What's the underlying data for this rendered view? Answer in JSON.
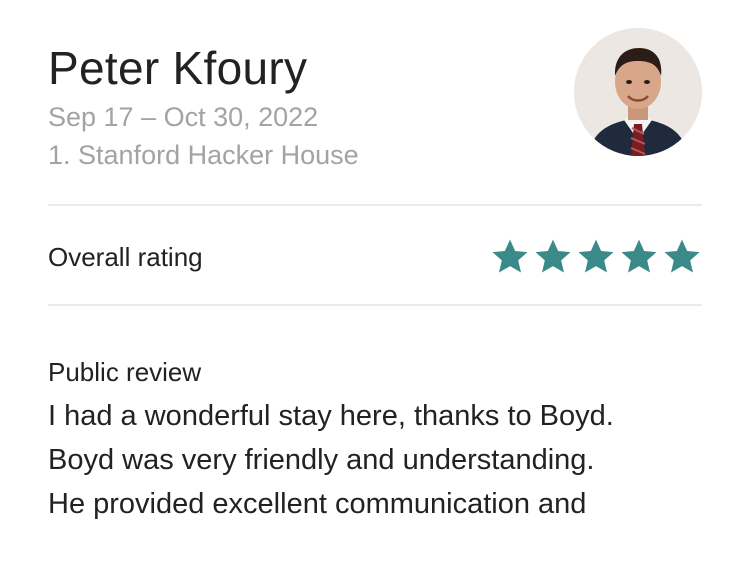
{
  "guest": {
    "name": "Peter Kfoury",
    "dates": "Sep 17 – Oct 30, 2022",
    "listing": "1. Stanford Hacker House",
    "avatar_icon": "guest-avatar-photo"
  },
  "rating": {
    "label": "Overall rating",
    "value": 5,
    "max": 5,
    "star_color": "#3b8a8a"
  },
  "review": {
    "heading": "Public review",
    "lines": [
      "I had a wonderful stay here, thanks to Boyd.",
      "Boyd was very friendly and understanding.",
      "He provided excellent communication and"
    ]
  }
}
